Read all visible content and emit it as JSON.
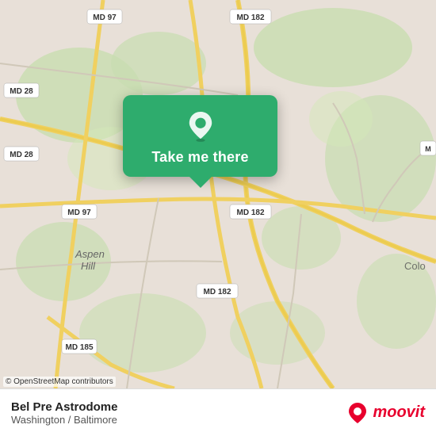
{
  "map": {
    "attribution": "© OpenStreetMap contributors",
    "location_name": "Bel Pre Astrodome",
    "region": "Washington / Baltimore",
    "popup": {
      "button_label": "Take me there"
    }
  },
  "branding": {
    "logo_text": "moovit"
  },
  "road_labels": [
    {
      "id": "md182_top",
      "text": "MD 182"
    },
    {
      "id": "md97_top",
      "text": "MD 97"
    },
    {
      "id": "md28_top_left",
      "text": "MD 28"
    },
    {
      "id": "md28_mid_left",
      "text": "MD 28"
    },
    {
      "id": "md97_mid",
      "text": "MD 97"
    },
    {
      "id": "md182_mid",
      "text": "MD 182"
    },
    {
      "id": "md182_bottom",
      "text": "MD 182"
    },
    {
      "id": "md185",
      "text": "MD 185"
    }
  ]
}
